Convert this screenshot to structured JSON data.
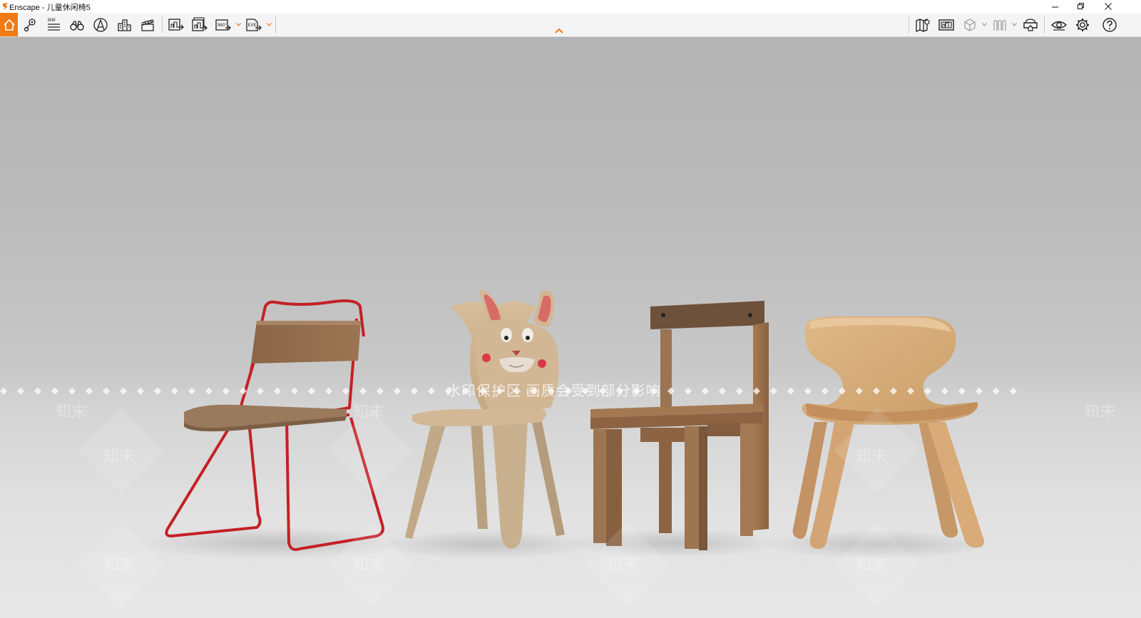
{
  "window": {
    "title": "Enscape - 儿童休闲椅5",
    "controls": {
      "minimize": "minimize-icon",
      "restore": "restore-icon",
      "close": "close-icon"
    }
  },
  "toolbar": {
    "accent_color": "#f07a14",
    "left_tools": [
      {
        "name": "home-icon",
        "active": true
      },
      {
        "name": "view-management-icon"
      },
      {
        "name": "bim-info-icon",
        "label": "BIM"
      },
      {
        "name": "binoculars-icon"
      },
      {
        "name": "site-context-icon"
      },
      {
        "name": "building-assets-icon"
      },
      {
        "name": "video-editor-icon"
      },
      {
        "name": "render-image-icon"
      },
      {
        "name": "batch-render-icon"
      },
      {
        "name": "panorama-360-icon",
        "label": "360°"
      },
      {
        "name": "export-exe-icon",
        "label": "EXE"
      }
    ],
    "right_tools": [
      {
        "name": "map-icon"
      },
      {
        "name": "screenshot-icon"
      },
      {
        "name": "box-view-icon"
      },
      {
        "name": "material-editor-icon"
      },
      {
        "name": "vr-headset-icon"
      },
      {
        "name": "visual-settings-icon"
      },
      {
        "name": "settings-gear-icon"
      },
      {
        "name": "help-icon",
        "label": "?"
      }
    ]
  },
  "viewport": {
    "watermark_text": "水印保护区  画质会受到部分影响",
    "watermark_logo": "知末",
    "chairs": [
      {
        "name": "red-metal-frame-chair",
        "frame_color": "#c42026"
      },
      {
        "name": "bunny-plywood-chair",
        "ear_color": "#d86c6a"
      },
      {
        "name": "wooden-block-chair"
      },
      {
        "name": "molded-wood-chair"
      }
    ]
  }
}
